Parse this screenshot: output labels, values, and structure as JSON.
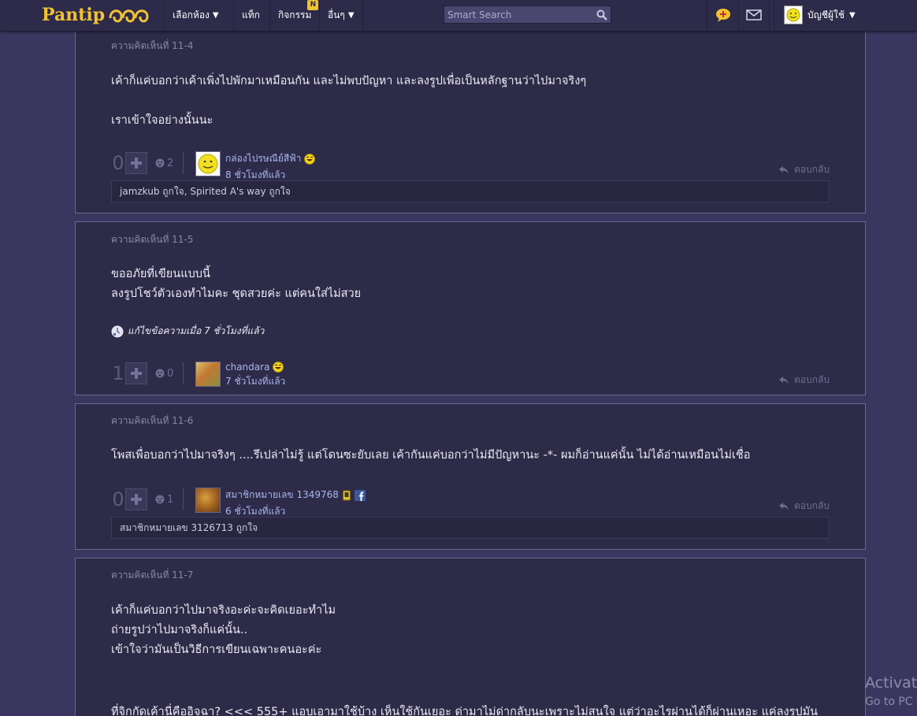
{
  "nav": {
    "logo_text": "Pantip",
    "menu": [
      {
        "label": "เลือกห้อง",
        "caret": "▼"
      },
      {
        "label": "แท็ก"
      },
      {
        "label": "กิจกรรม",
        "badge": "N"
      },
      {
        "label": "อื่นๆ",
        "caret": "▼"
      }
    ],
    "search_placeholder": "Smart Search",
    "account_label": "บัญชีผู้ใช้",
    "account_caret": "▼"
  },
  "comments": [
    {
      "label": "ความคิดเห็นที่ 11-4",
      "lines": [
        "เค้าก็แค่บอกว่าเค้าเพิ่งไปพักมาเหมือนกัน และไม่พบปัญหา และลงรูปเพื่อเป็นหลักฐานว่าไปมาจริงๆ",
        "",
        "เราเข้าใจอย่างนั้นนะ"
      ],
      "votes": "0",
      "emotions": "2",
      "author": "กล่องไปรษณีย์สีฟ้า",
      "time": "8 ชั่วโมงที่แล้ว",
      "reply": "ตอบกลับ",
      "likes": "jamzkub ถูกใจ, Spirited A's way ถูกใจ"
    },
    {
      "label": "ความคิดเห็นที่ 11-5",
      "lines": [
        "ขออภัยที่เขียนแบบนี้",
        "ลงรูปโชว์ตัวเองทำไมคะ ชุดสวยค่ะ แต่คนใส่ไม่สวย"
      ],
      "edit_note": "แก้ไขข้อความเมื่อ 7 ชั่วโมงที่แล้ว",
      "votes": "1",
      "emotions": "0",
      "author": "chandara",
      "time": "7 ชั่วโมงที่แล้ว",
      "reply": "ตอบกลับ"
    },
    {
      "label": "ความคิดเห็นที่ 11-6",
      "lines": [
        "โพสเพื่อบอกว่าไปมาจริงๆ ....รึเปล่าไม่รู้ แต่โดนซะยับเลย เค้ากันแค่บอกว่าไม่มีปัญหานะ -*- ผมก็อ่านแค่นั้น ไม่ได้อ่านเหมือนไม่เชื่อ"
      ],
      "votes": "0",
      "emotions": "1",
      "author": "สมาชิกหมายเลข 1349768",
      "time": "6 ชั่วโมงที่แล้ว",
      "reply": "ตอบกลับ",
      "likes": "สมาชิกหมายเลข 3126713 ถูกใจ"
    },
    {
      "label": "ความคิดเห็นที่ 11-7",
      "lines": [
        "เค้าก็แค่บอกว่าไปมาจริงอะค่ะจะคิดเยอะทำไม",
        "ถ่ายรูปว่าไปมาจริงก็แค่นั้น..",
        "เข้าใจว่ามันเป็นวิธีการเขียนเฉพาะคนอะค่ะ",
        "",
        "",
        "ที่จิกกัดเค้านี่คืออิจฉา? <<< 555+ แอบเอามาใช้บ้าง เห็นใช้กันเยอะ ด่ามาไม่ด่ากลับนะเพราะไม่สนใจ แต่ว่าอะไรผ่านได้ก็ผ่านเหอะ แค่ลงรูปมัน"
      ]
    }
  ],
  "watermark": {
    "line1": "Activate",
    "line2": "Go to PC s"
  },
  "colors": {
    "background": "#3b3660",
    "card": "#2e2b48",
    "accent": "#f2c230",
    "link": "#a8b6f0"
  }
}
